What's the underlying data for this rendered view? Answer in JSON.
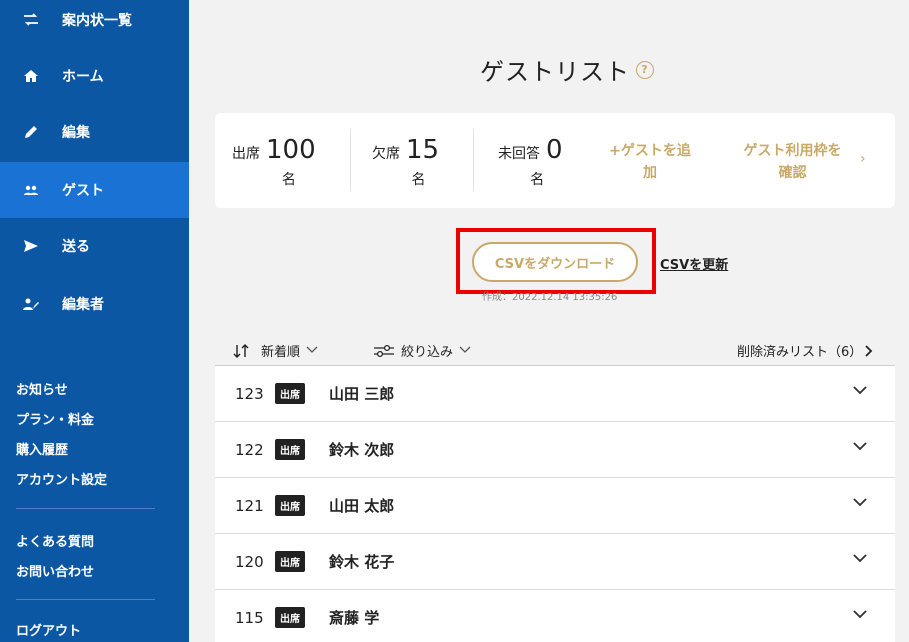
{
  "sidebar": {
    "nav": [
      {
        "label": "案内状一覧",
        "icon": "swap-icon"
      },
      {
        "label": "ホーム",
        "icon": "home-icon"
      },
      {
        "label": "編集",
        "icon": "pencil-icon"
      },
      {
        "label": "ゲスト",
        "icon": "people-icon",
        "active": true
      },
      {
        "label": "送る",
        "icon": "send-icon"
      },
      {
        "label": "編集者",
        "icon": "person-edit-icon"
      }
    ],
    "links_group1": [
      "お知らせ",
      "プラン・料金",
      "購入履歴",
      "アカウント設定"
    ],
    "links_group2": [
      "よくある質問",
      "お問い合わせ"
    ],
    "logout": "ログアウト"
  },
  "main": {
    "title": "ゲストリスト",
    "help": "?",
    "stats": {
      "attend_label": "出席",
      "attend_count": "100",
      "absent_label": "欠席",
      "absent_count": "15",
      "noreply_label": "未回答",
      "noreply_count": "0",
      "unit": "名"
    },
    "actions": {
      "add_guest_line1": "+ゲストを追",
      "add_guest_line2": "加",
      "confirm_line1": "ゲスト利用枠を",
      "confirm_line2": "確認",
      "chevron": "›"
    },
    "csv": {
      "download_label": "CSVをダウンロード",
      "update_label": "CSVを更新",
      "created_at": "作成：2022.12.14 13:35:26"
    },
    "toolbar": {
      "sort_label": "新着順",
      "filter_label": "絞り込み",
      "deleted_label": "削除済みリスト（6）"
    },
    "guests": [
      {
        "num": "123",
        "status": "出席",
        "name": "山田 三郎"
      },
      {
        "num": "122",
        "status": "出席",
        "name": "鈴木 次郎"
      },
      {
        "num": "121",
        "status": "出席",
        "name": "山田 太郎"
      },
      {
        "num": "120",
        "status": "出席",
        "name": "鈴木 花子"
      },
      {
        "num": "115",
        "status": "出席",
        "name": "斎藤 学"
      }
    ]
  },
  "colors": {
    "sidebar": "#0b57a4",
    "sidebar_active": "#1a73d4",
    "gold": "#c9a96a",
    "highlight": "#ee0000"
  }
}
